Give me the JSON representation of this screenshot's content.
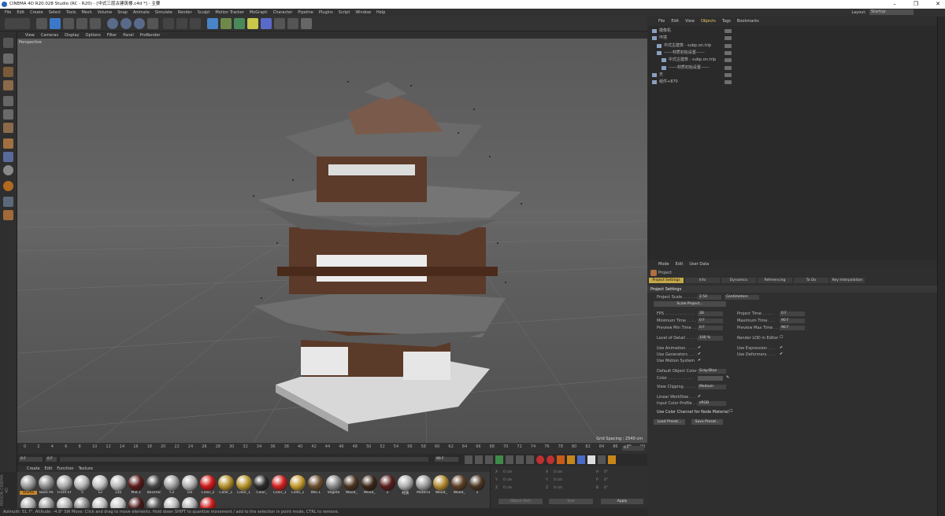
{
  "window": {
    "title": "CINEMA 4D R20.028 Studio (RC - R20) - [中式三层古建筑楼.c4d *] - 主要"
  },
  "menubar": {
    "items": [
      "File",
      "Edit",
      "Create",
      "Select",
      "Tools",
      "Mesh",
      "Volume",
      "Snap",
      "Animate",
      "Simulate",
      "Render",
      "Sculpt",
      "Motion Tracker",
      "MoGraph",
      "Character",
      "Pipeline",
      "Plugins",
      "Script",
      "Window",
      "Help"
    ],
    "layout_label": "Layout:",
    "layout_value": "Startup"
  },
  "viewport": {
    "menu": [
      "View",
      "Cameras",
      "Display",
      "Options",
      "Filter",
      "Panel",
      "ProRender"
    ],
    "label": "Perspective",
    "grid_spacing": "Grid Spacing : 2540 cm"
  },
  "timeline": {
    "ticks": [
      "0",
      "2",
      "4",
      "6",
      "8",
      "10",
      "12",
      "14",
      "16",
      "18",
      "20",
      "22",
      "24",
      "26",
      "28",
      "30",
      "32",
      "34",
      "36",
      "38",
      "40",
      "42",
      "44",
      "46",
      "48",
      "50",
      "52",
      "54",
      "56",
      "58",
      "60",
      "62",
      "64",
      "66",
      "68",
      "70",
      "72",
      "74",
      "76",
      "78",
      "80",
      "82",
      "84",
      "86",
      "88",
      "90"
    ],
    "end_field": "0 F",
    "start_field": "0 F",
    "start2_field": "0 F",
    "end2_field": "90 F",
    "end3_field": "90 F"
  },
  "materials": {
    "menu": [
      "Create",
      "Edit",
      "Function",
      "Texture"
    ],
    "row1": [
      {
        "label": "Stuffio",
        "color": "#9a9a9a",
        "selected": true
      },
      {
        "label": "Back Pe",
        "color": "#8c8c8c"
      },
      {
        "label": "Front Ef",
        "color": "#aaaaaa"
      },
      {
        "label": "5",
        "color": "#b5b5b5"
      },
      {
        "label": "12",
        "color": "#c0c0c0"
      },
      {
        "label": "110",
        "color": "#b8b8b8"
      },
      {
        "label": "Mat.1",
        "color": "#5a1a1a"
      },
      {
        "label": "Backfac",
        "color": "#444444"
      },
      {
        "label": "C2",
        "color": "#a0a0a0"
      },
      {
        "label": "Ge",
        "color": "#b0b0b0"
      },
      {
        "label": "Color_2",
        "color": "#d01818"
      },
      {
        "label": "Color_1",
        "color": "#b3902c"
      },
      {
        "label": "Color_1",
        "color": "#b8962e"
      },
      {
        "label": "Color_",
        "color": "#2a2a2a"
      },
      {
        "label": "Color_1",
        "color": "#d02020"
      },
      {
        "label": "Color_1",
        "color": "#c49a2e"
      },
      {
        "label": "Wlo.1",
        "color": "#6b4e2e"
      },
      {
        "label": "Vegeta",
        "color": "#8a8a8a"
      },
      {
        "label": "Wood_",
        "color": "#4a3220"
      },
      {
        "label": "Wood_",
        "color": "#3a2618"
      },
      {
        "label": "2",
        "color": "#5a1e1e"
      },
      {
        "label": "材质",
        "color": "#b0b0b0"
      },
      {
        "label": "Materia",
        "color": "#9c9c9c"
      },
      {
        "label": "Wood_",
        "color": "#b28a30"
      },
      {
        "label": "Wood_",
        "color": "#5c3e24"
      },
      {
        "label": "5",
        "color": "#4a3422"
      }
    ],
    "row2": [
      {
        "color": "#aaaaaa"
      },
      {
        "color": "#9a9a9a"
      },
      {
        "color": "#b0b0b0"
      },
      {
        "color": "#8a8a8a"
      },
      {
        "color": "#bbbbbb"
      },
      {
        "color": "#c4c4c4"
      },
      {
        "color": "#4a1818"
      },
      {
        "color": "#555555"
      },
      {
        "color": "#b8b8b8"
      },
      {
        "color": "#b0b0b0"
      },
      {
        "color": "#cc1c1c"
      }
    ]
  },
  "coords": {
    "rows": [
      [
        "X",
        "0 cm",
        "X",
        "0 cm",
        "H",
        "0°"
      ],
      [
        "Y",
        "0 cm",
        "Y",
        "0 cm",
        "P",
        "0°"
      ],
      [
        "Z",
        "0 cm",
        "Z",
        "0 cm",
        "B",
        "0°"
      ]
    ],
    "mode": "Object (Rel)",
    "size": "Size",
    "apply": "Apply"
  },
  "statusbar": {
    "text": "Azimuth: 51.7°, Altitude: -4.8°  SW     Move: Click and drag to move elements. Hold down SHIFT to quantize movement / add to the selection in point mode, CTRL to remove."
  },
  "maxon": "MAXON CINEMA 4D",
  "objmanager": {
    "menu": [
      "File",
      "Edit",
      "View",
      "Objects",
      "Tags",
      "Bookmarks"
    ],
    "rows": [
      {
        "name": "摄像机",
        "indent": 0
      },
      {
        "name": "环境",
        "indent": 0
      },
      {
        "name": "中式古建筑 - subp.on.trip",
        "indent": 1
      },
      {
        "name": "------材质初始设置------",
        "indent": 1
      },
      {
        "name": "中式古建筑 - subp.on.trip",
        "indent": 2
      },
      {
        "name": "------材质初始设置------",
        "indent": 2
      },
      {
        "name": "天",
        "indent": 0
      },
      {
        "name": "组件+870",
        "indent": 0
      }
    ]
  },
  "attribute": {
    "menu": [
      "Mode",
      "Edit",
      "User Data"
    ],
    "object": "Project",
    "tabs": [
      "Project Settings",
      "Info",
      "Dynamics",
      "Referencing",
      "To Do",
      "Key Interpolation"
    ],
    "section": "Project Settings",
    "project_scale_label": "Project Scale . . . . . .",
    "project_scale_value": "2.54",
    "project_scale_unit": "Centimeters",
    "scale_project_btn": "Scale Project...",
    "fps_label": "FPS . . . . . . . . . . . .",
    "fps_value": "30",
    "project_time_label": "Project Time . . . . .",
    "project_time_value": "0 F",
    "min_time_label": "Minimum Time . . . .",
    "min_time_value": "0 F",
    "max_time_label": "Maximum Time . . .",
    "max_time_value": "90 F",
    "prev_min_label": "Preview Min Time . .",
    "prev_min_value": "0 F",
    "prev_max_label": "Preview Max Time . .",
    "prev_max_value": "90 F",
    "lod_label": "Level of Detail . . . . .",
    "lod_value": "100 %",
    "render_lod_label": "Render LOD in Editor",
    "use_anim": "Use Animation. . . . .",
    "use_expr": "Use Expression . . .",
    "use_gen": "Use Generators . . . .",
    "use_def": "Use Deformers. . . .",
    "use_motion": "Use Motion System",
    "def_obj_color_label": "Default Object Color",
    "def_obj_color_value": "Gray-Blue",
    "color_label": "Color . . . . . . . . . .",
    "view_clip_label": "View Clipping . . . . .",
    "view_clip_value": "Medium",
    "linear_wf_label": "Linear Workflow . . . .",
    "input_profile_label": "Input Color Profile . .",
    "input_profile_value": "sRGB",
    "node_mat_label": "Use Color Channel for Node Material",
    "load_preset": "Load Preset...",
    "save_preset": "Save Preset..."
  }
}
